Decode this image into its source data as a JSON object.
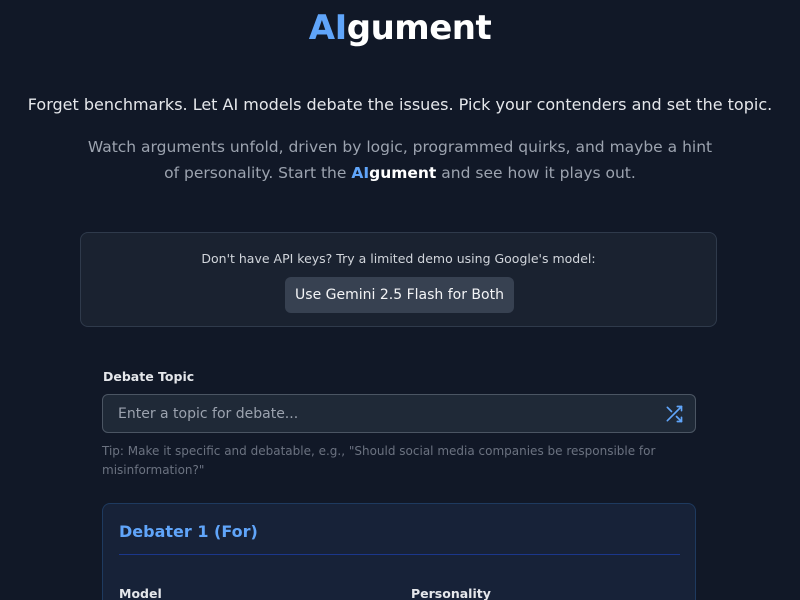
{
  "header": {
    "logo_ai": "AI",
    "logo_rest": "gument"
  },
  "hero": {
    "tagline": "Forget benchmarks. Let AI models debate the issues. Pick your contenders and set the topic.",
    "subtext_before": "Watch arguments unfold, driven by logic, programmed quirks, and maybe a hint of personality. Start the ",
    "subtext_brand_ai": "AI",
    "subtext_brand_rest": "gument",
    "subtext_after": " and see how it plays out."
  },
  "demo": {
    "prompt": "Don't have API keys? Try a limited demo using Google's model:",
    "button_label": "Use Gemini 2.5 Flash for Both"
  },
  "topic": {
    "label": "Debate Topic",
    "value": "",
    "placeholder": "Enter a topic for debate...",
    "shuffle_icon": "shuffle-icon",
    "tip": "Tip: Make it specific and debatable, e.g., \"Should social media companies be responsible for misinformation?\""
  },
  "debater1": {
    "title": "Debater 1 (For)",
    "model_label": "Model",
    "personality_label": "Personality"
  },
  "colors": {
    "background": "#111827",
    "accent": "#60a5fa",
    "card": "#1a2230",
    "button": "#374151"
  }
}
